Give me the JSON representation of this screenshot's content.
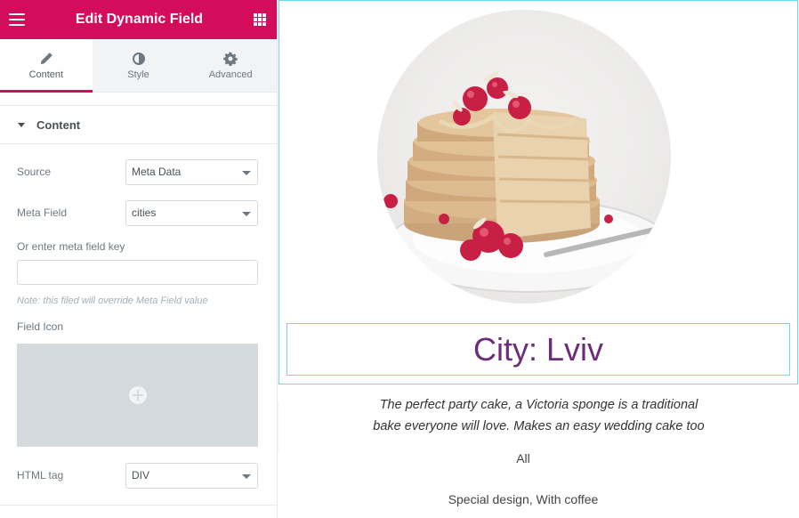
{
  "panel": {
    "title": "Edit Dynamic Field",
    "tabs": [
      {
        "label": "Content",
        "active": true
      },
      {
        "label": "Style",
        "active": false
      },
      {
        "label": "Advanced",
        "active": false
      }
    ],
    "section_title": "Content",
    "source": {
      "label": "Source",
      "value": "Meta Data"
    },
    "meta_field": {
      "label": "Meta Field",
      "value": "cities"
    },
    "meta_key": {
      "label": "Or enter meta field key",
      "value": "",
      "placeholder": ""
    },
    "note": "Note: this filed will override Meta Field value",
    "field_icon": {
      "label": "Field Icon"
    },
    "html_tag": {
      "label": "HTML tag",
      "value": "DIV"
    }
  },
  "colors": {
    "header": "#d30c5c",
    "title_text": "#6b2d7a",
    "widget_outline": "#71d7f7"
  },
  "preview": {
    "city_title": "City: Lviv",
    "description_line1": "The perfect party cake, a Victoria sponge is a traditional",
    "description_line2": "bake everyone will love. Makes an easy wedding cake too",
    "category": "All",
    "tags": "Special design, With coffee"
  }
}
